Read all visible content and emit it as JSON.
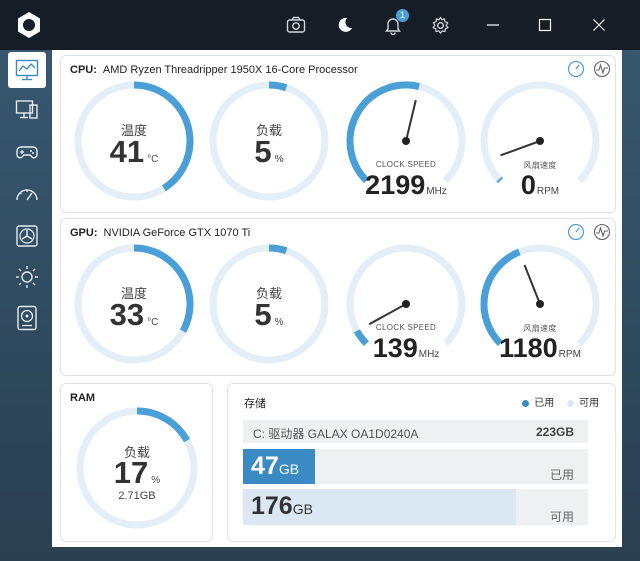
{
  "titlebar": {
    "notification_count": "1",
    "icons": [
      "camera-icon",
      "moon-icon",
      "bell-icon",
      "gear-icon"
    ],
    "window_controls": [
      "minimize-icon",
      "maximize-icon",
      "close-icon"
    ]
  },
  "sidebar": {
    "items": [
      "dashboard-icon",
      "monitor-icon",
      "gamepad-icon",
      "speedometer-icon",
      "fan-icon",
      "brightness-icon",
      "harddisk-icon"
    ]
  },
  "colors": {
    "accent": "#4a9fd6",
    "track": "#e4eef7"
  },
  "cpu": {
    "label": "CPU:",
    "name": "AMD Ryzen Threadripper 1950X 16-Core Processor",
    "temp_label": "温度",
    "temp_value": "41",
    "temp_unit": "°C",
    "temp_fraction": 0.41,
    "load_label": "负载",
    "load_value": "5",
    "load_unit": "%",
    "load_fraction": 0.05,
    "clock_label": "CLOCK SPEED",
    "clock_value": "2199",
    "clock_unit": "MHz",
    "clock_fraction": 0.55,
    "fan_label": "风扇速度",
    "fan_value": "0",
    "fan_unit": "RPM",
    "fan_fraction": 0.0
  },
  "gpu": {
    "label": "GPU:",
    "name": "NVIDIA GeForce GTX 1070 Ti",
    "temp_label": "温度",
    "temp_value": "33",
    "temp_unit": "°C",
    "temp_fraction": 0.33,
    "load_label": "负载",
    "load_value": "5",
    "load_unit": "%",
    "load_fraction": 0.05,
    "clock_label": "CLOCK SPEED",
    "clock_value": "139",
    "clock_unit": "MHz",
    "clock_fraction": 0.06,
    "fan_label": "风扇速度",
    "fan_value": "1180",
    "fan_unit": "RPM",
    "fan_fraction": 0.42
  },
  "ram": {
    "title": "RAM",
    "load_label": "负载",
    "load_value": "17",
    "load_unit": "%",
    "used": "2.71GB",
    "load_fraction": 0.17
  },
  "storage": {
    "title": "存储",
    "legend_used": "已用",
    "legend_free": "可用",
    "drive_name": "C: 驱动器 GALAX OA1D0240A",
    "drive_total": "223GB",
    "used_value": "47",
    "used_unit": "GB",
    "used_label": "已用",
    "used_fraction": 0.21,
    "free_value": "176",
    "free_unit": "GB",
    "free_label": "可用",
    "free_fraction": 0.79
  }
}
